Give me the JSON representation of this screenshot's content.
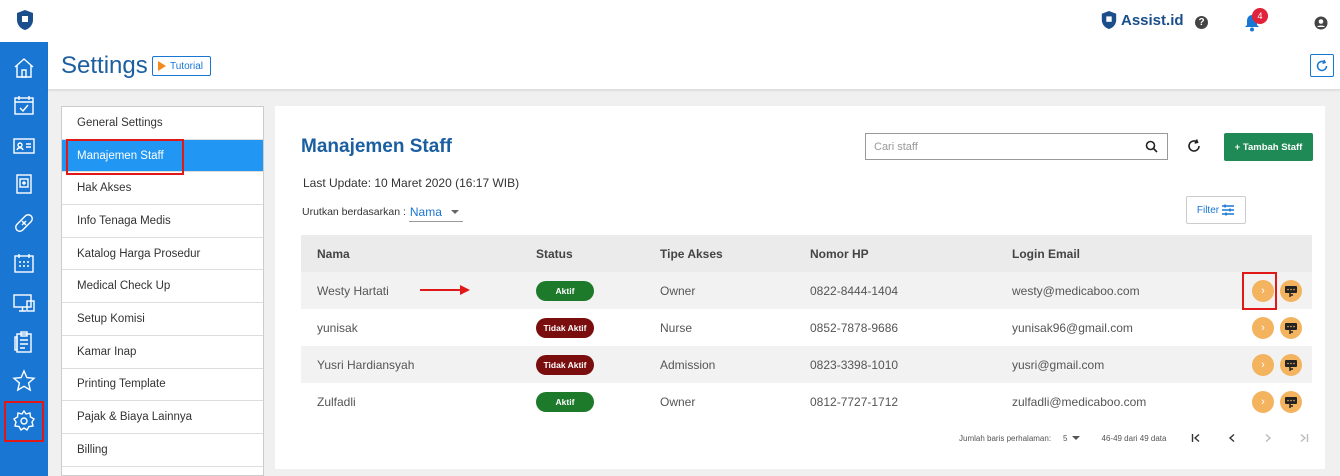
{
  "topbar": {
    "brand": "Assist.id",
    "help_icon": "?",
    "notification_count": "4"
  },
  "nav": [
    "home-icon",
    "calendar-check-icon",
    "id-card-icon",
    "medical-record-icon",
    "bandage-icon",
    "schedule-icon",
    "monitor-icon",
    "clipboard-icon",
    "star-icon",
    "settings-icon"
  ],
  "header": {
    "title": "Settings",
    "tutorial_label": "Tutorial"
  },
  "settings_menu": [
    {
      "label": "General Settings",
      "active": false
    },
    {
      "label": "Manajemen Staff",
      "active": true
    },
    {
      "label": "Hak Akses",
      "active": false
    },
    {
      "label": "Info Tenaga Medis",
      "active": false
    },
    {
      "label": "Katalog Harga Prosedur",
      "active": false
    },
    {
      "label": "Medical Check Up",
      "active": false
    },
    {
      "label": "Setup Komisi",
      "active": false
    },
    {
      "label": "Kamar Inap",
      "active": false
    },
    {
      "label": "Printing Template",
      "active": false
    },
    {
      "label": "Pajak & Biaya Lainnya",
      "active": false
    },
    {
      "label": "Billing",
      "active": false
    }
  ],
  "main": {
    "title": "Manajemen Staff",
    "search_placeholder": "Cari staff",
    "add_button": "+ Tambah Staff",
    "last_update": "Last Update: 10 Maret 2020 (16:17 WIB)",
    "sort_label": "Urutkan berdasarkan :",
    "sort_value": "Nama",
    "filter_label": "Filter"
  },
  "table": {
    "headers": [
      "Nama",
      "Status",
      "Tipe Akses",
      "Nomor HP",
      "Login Email"
    ],
    "rows": [
      {
        "nama": "Westy Hartati",
        "status": "Aktif",
        "active": true,
        "tipe": "Owner",
        "hp": "0822-8444-1404",
        "email": "westy@medicaboo.com"
      },
      {
        "nama": "yunisak",
        "status": "Tidak Aktif",
        "active": false,
        "tipe": "Nurse",
        "hp": "0852-7878-9686",
        "email": "yunisak96@gmail.com"
      },
      {
        "nama": "Yusri Hardiansyah",
        "status": "Tidak Aktif",
        "active": false,
        "tipe": "Admission",
        "hp": "0823-3398-1010",
        "email": "yusri@gmail.com"
      },
      {
        "nama": "Zulfadli",
        "status": "Aktif",
        "active": true,
        "tipe": "Owner",
        "hp": "0812-7727-1712",
        "email": "zulfadli@medicaboo.com"
      }
    ]
  },
  "pagination": {
    "rows_label": "Jumlah baris perhalaman:",
    "rows_value": "5",
    "range": "46-49 dari 49 data"
  },
  "colors": {
    "primary": "#1976d2",
    "active_menu": "#2196f3",
    "add_button": "#1f8a55",
    "status_active": "#1e7a2b",
    "status_inactive": "#7a0d0d",
    "action": "#f4b35e",
    "annotation": "#e01818"
  }
}
